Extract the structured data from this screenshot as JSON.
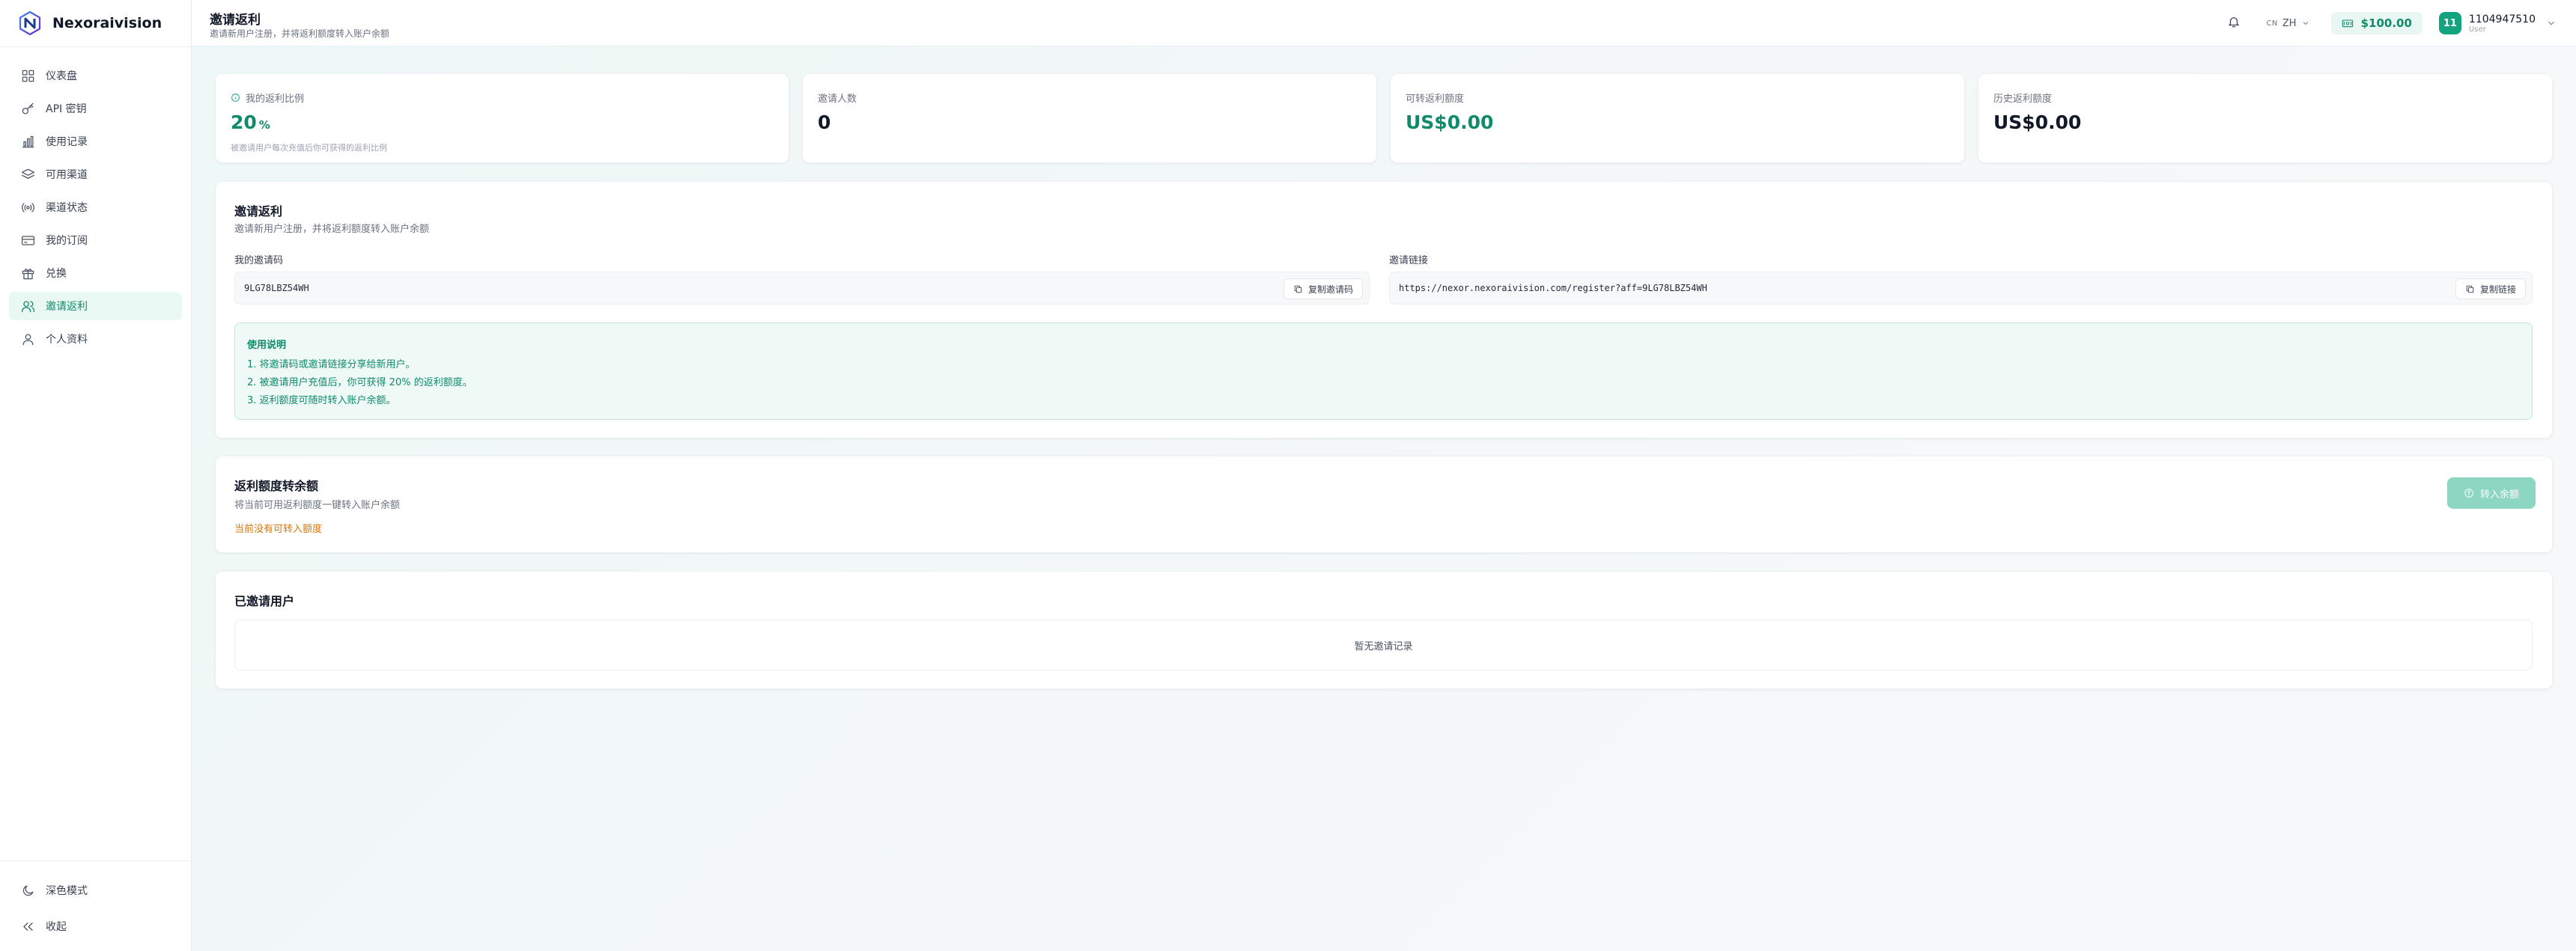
{
  "brand": {
    "name": "Nexoraivision"
  },
  "sidebar": {
    "items": [
      {
        "label": "仪表盘",
        "icon": "dashboard-icon"
      },
      {
        "label": "API 密钥",
        "icon": "key-icon"
      },
      {
        "label": "使用记录",
        "icon": "bar-chart-icon"
      },
      {
        "label": "可用渠道",
        "icon": "layers-icon"
      },
      {
        "label": "渠道状态",
        "icon": "signal-icon"
      },
      {
        "label": "我的订阅",
        "icon": "credit-card-icon"
      },
      {
        "label": "兑换",
        "icon": "gift-icon"
      },
      {
        "label": "邀请返利",
        "icon": "users-icon",
        "active": true
      },
      {
        "label": "个人资料",
        "icon": "user-icon"
      }
    ],
    "dark_mode_label": "深色模式",
    "collapse_label": "收起"
  },
  "header": {
    "title": "邀请返利",
    "subtitle": "邀请新用户注册，并将返利额度转入账户余额",
    "lang_code": "CN",
    "lang_label": "ZH",
    "balance": "$100.00",
    "user": {
      "initials": "11",
      "name": "1104947510",
      "role": "User"
    }
  },
  "stats": [
    {
      "label": "我的返利比例",
      "value": "20",
      "unit": "%",
      "desc": "被邀请用户每次充值后你可获得的返利比例"
    },
    {
      "label": "邀请人数",
      "value": "0"
    },
    {
      "label": "可转返利额度",
      "value": "US$0.00"
    },
    {
      "label": "历史返利额度",
      "value": "US$0.00"
    }
  ],
  "invite": {
    "title": "邀请返利",
    "subtitle": "邀请新用户注册，并将返利额度转入账户余额",
    "code_label": "我的邀请码",
    "code": "9LG78LBZ54WH",
    "copy_code_label": "复制邀请码",
    "link_label": "邀请链接",
    "link": "https://nexor.nexoraivision.com/register?aff=9LG78LBZ54WH",
    "copy_link_label": "复制链接",
    "notes_title": "使用说明",
    "notes": [
      "1. 将邀请码或邀请链接分享给新用户。",
      "2. 被邀请用户充值后，你可获得 20% 的返利额度。",
      "3. 返利额度可随时转入账户余额。"
    ]
  },
  "transfer": {
    "title": "返利额度转余额",
    "subtitle": "将当前可用返利额度一键转入账户余额",
    "warning": "当前没有可转入额度",
    "button_label": "转入余额"
  },
  "invited": {
    "title": "已邀请用户",
    "empty": "暂无邀请记录"
  },
  "colors": {
    "accent": "#0f8a6a",
    "accent_bg": "#eaf8f4",
    "warning": "#d97706"
  }
}
